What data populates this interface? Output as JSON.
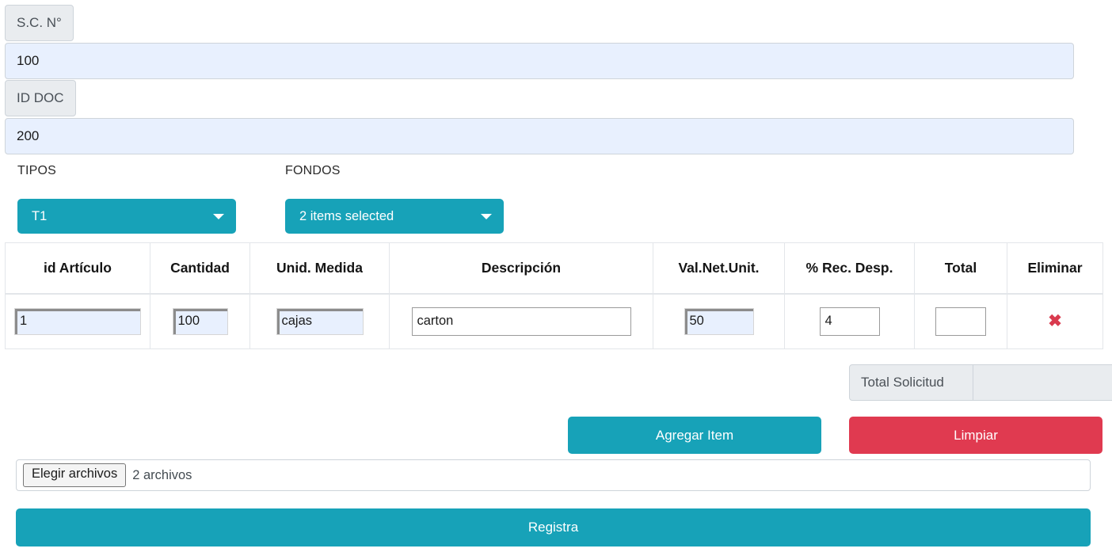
{
  "form": {
    "sc_numero": {
      "label": "S.C. N°",
      "value": "100"
    },
    "id_doc": {
      "label": "ID DOC",
      "value": "200"
    },
    "tipos": {
      "label": "TIPOS",
      "selected": "T1"
    },
    "fondos": {
      "label": "FONDOS",
      "selected": "2 items selected"
    }
  },
  "table": {
    "headers": [
      "id Artículo",
      "Cantidad",
      "Unid. Medida",
      "Descripción",
      "Val.Net.Unit.",
      "% Rec. Desp.",
      "Total",
      "Eliminar"
    ],
    "rows": [
      {
        "id_articulo": "1",
        "cantidad": "100",
        "unid_medida": "cajas",
        "descripcion": "carton",
        "val_net_unit": "50",
        "rec_desp": "4",
        "total": "",
        "eliminar_icon": "✖"
      }
    ]
  },
  "totals": {
    "label": "Total Solicitud",
    "value": ""
  },
  "actions": {
    "agregar_item": "Agregar Item",
    "limpiar": "Limpiar",
    "registra": "Registra"
  },
  "file_upload": {
    "button_label": "Elegir archivos",
    "status_text": "2 archivos"
  },
  "colors": {
    "teal": "#17a2b8",
    "red": "#e03a50",
    "autofill_blue": "#e8f0fe",
    "group_gray": "#e9ecef",
    "delete_red": "#d93a4e"
  }
}
